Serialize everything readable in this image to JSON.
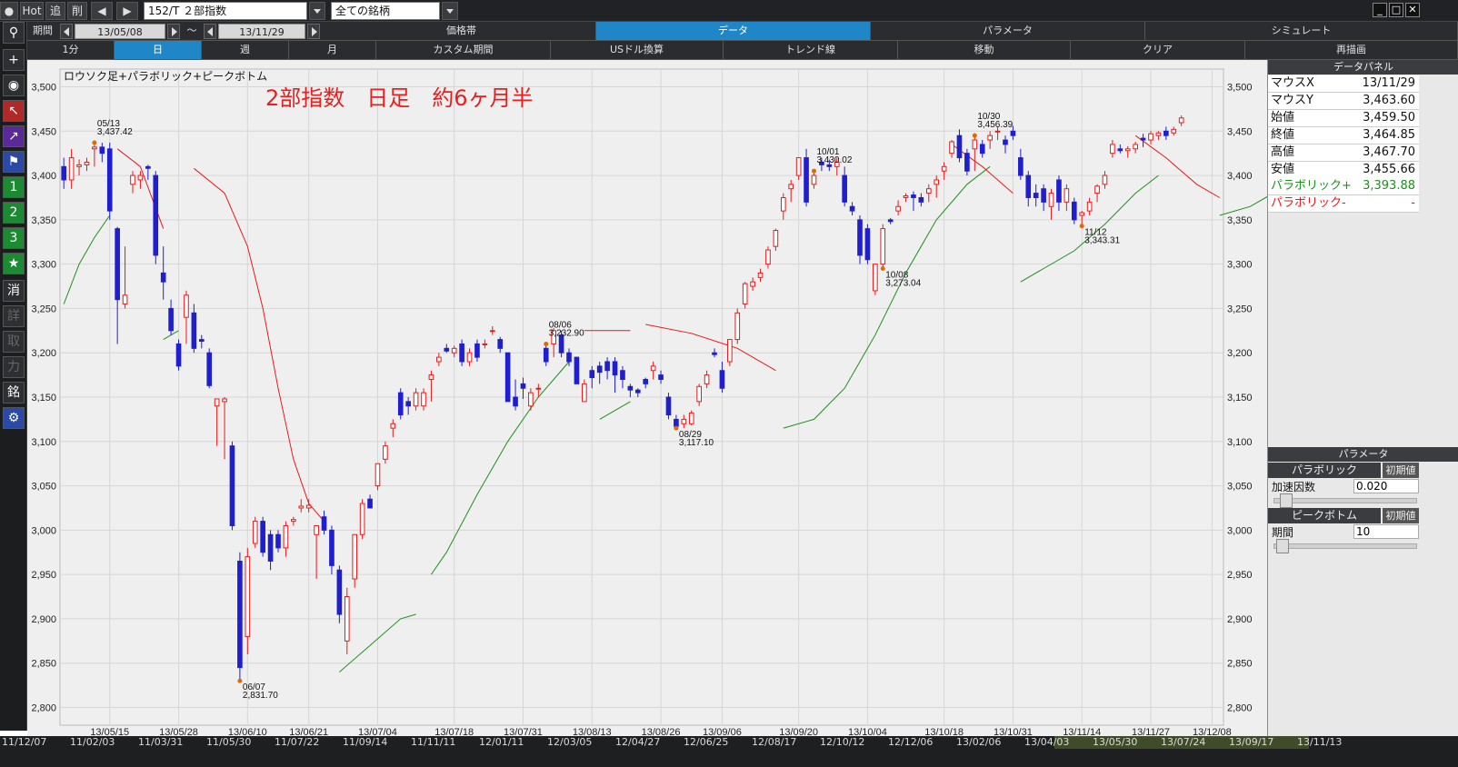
{
  "toolbar": {
    "hot": "Hot",
    "add": "追",
    "del": "削",
    "symbol": "152/T ２部指数",
    "filter": "全ての銘柄"
  },
  "period_row": {
    "label": "期間",
    "from": "13/05/08",
    "tilde": "～",
    "to": "13/11/29",
    "tabs": [
      "価格帯",
      "データ",
      "パラメータ",
      "シミュレート"
    ],
    "active_tab": 1
  },
  "interval_row": {
    "intervals": [
      "1分",
      "日",
      "週",
      "月"
    ],
    "active_interval": 1,
    "buttons": [
      "カスタム期間",
      "USドル換算",
      "トレンド線",
      "移動",
      "クリア",
      "再描画"
    ]
  },
  "left_tools": {
    "num1": "1",
    "num2": "2",
    "num3": "3",
    "k1": "消",
    "k2": "詳",
    "k3": "取",
    "k4": "力",
    "k5": "銘"
  },
  "chart_data": {
    "type": "candlestick",
    "indicator_label": "ロウソク足+パラボリック+ピークボトム",
    "title": "2部指数　日足　約6ヶ月半",
    "ylim": [
      2780,
      3520
    ],
    "y_ticks": [
      3500,
      3450,
      3400,
      3350,
      3300,
      3250,
      3200,
      3150,
      3100,
      3050,
      3000,
      2950,
      2900,
      2850,
      2800
    ],
    "y_tick_labels": [
      "3,500",
      "3,450",
      "3,400",
      "3,350",
      "3,300",
      "3,250",
      "3,200",
      "3,150",
      "3,100",
      "3,050",
      "3,000",
      "2,950",
      "2,900",
      "2,850",
      "2,800"
    ],
    "x_tick_labels": [
      "13/05/15",
      "13/05/28",
      "13/06/10",
      "13/06/21",
      "13/07/04",
      "13/07/18",
      "13/07/31",
      "13/08/13",
      "13/08/26",
      "13/09/06",
      "13/09/20",
      "13/10/04",
      "13/10/18",
      "13/10/31",
      "13/11/14",
      "13/11/27",
      "13/12/08"
    ],
    "x_tick_index": [
      6,
      15,
      24,
      32,
      41,
      51,
      60,
      69,
      78,
      86,
      96,
      105,
      115,
      124,
      133,
      142,
      150
    ],
    "n_slots": 152,
    "candles": [
      [
        3410,
        3420,
        3385,
        3395
      ],
      [
        3395,
        3430,
        3385,
        3420
      ],
      [
        3410,
        3418,
        3400,
        3412
      ],
      [
        3412,
        3420,
        3405,
        3415
      ],
      [
        3430,
        3437,
        3410,
        3432
      ],
      [
        3432,
        3437,
        3415,
        3425
      ],
      [
        3430,
        3437,
        3350,
        3360
      ],
      [
        3340,
        3342,
        3210,
        3260
      ],
      [
        3255,
        3320,
        3250,
        3265
      ],
      [
        3390,
        3405,
        3380,
        3400
      ],
      [
        3395,
        3405,
        3385,
        3400
      ],
      [
        3410,
        3412,
        3395,
        3408
      ],
      [
        3400,
        3405,
        3300,
        3310
      ],
      [
        3290,
        3320,
        3260,
        3280
      ],
      [
        3250,
        3260,
        3220,
        3225
      ],
      [
        3210,
        3215,
        3180,
        3185
      ],
      [
        3240,
        3270,
        3210,
        3265
      ],
      [
        3245,
        3255,
        3200,
        3205
      ],
      [
        3215,
        3220,
        3205,
        3213
      ],
      [
        3200,
        3205,
        3160,
        3163
      ],
      [
        3140,
        3145,
        3095,
        3148
      ],
      [
        3145,
        3150,
        3080,
        3148
      ],
      [
        3095,
        3100,
        3000,
        3005
      ],
      [
        2965,
        2975,
        2830,
        2845
      ],
      [
        2880,
        2980,
        2860,
        2970
      ],
      [
        2985,
        3015,
        2980,
        3010
      ],
      [
        3010,
        3015,
        2970,
        2975
      ],
      [
        2995,
        3000,
        2955,
        2965
      ],
      [
        2995,
        3000,
        2975,
        2980
      ],
      [
        2980,
        3010,
        2970,
        3005
      ],
      [
        3010,
        3015,
        3005,
        3012
      ],
      [
        3025,
        3035,
        3020,
        3027
      ],
      [
        3025,
        3035,
        3020,
        3028
      ],
      [
        2995,
        3000,
        2945,
        3005
      ],
      [
        3015,
        3022,
        2995,
        3000
      ],
      [
        3000,
        3005,
        2950,
        2960
      ],
      [
        2955,
        2960,
        2895,
        2905
      ],
      [
        2875,
        2935,
        2860,
        2925
      ],
      [
        2945,
        2995,
        2935,
        2995
      ],
      [
        2995,
        3035,
        2990,
        3030
      ],
      [
        3035,
        3030,
        3040,
        3025
      ],
      [
        3050,
        3075,
        3045,
        3075
      ],
      [
        3080,
        3100,
        3075,
        3095
      ],
      [
        3115,
        3125,
        3105,
        3120
      ],
      [
        3155,
        3160,
        3125,
        3130
      ],
      [
        3145,
        3150,
        3130,
        3140
      ],
      [
        3140,
        3160,
        3135,
        3155
      ],
      [
        3140,
        3160,
        3135,
        3155
      ],
      [
        3170,
        3180,
        3145,
        3175
      ],
      [
        3190,
        3200,
        3185,
        3195
      ],
      [
        3205,
        3210,
        3200,
        3202
      ],
      [
        3200,
        3208,
        3195,
        3205
      ],
      [
        3210,
        3215,
        3185,
        3190
      ],
      [
        3190,
        3205,
        3185,
        3200
      ],
      [
        3210,
        3215,
        3190,
        3195
      ],
      [
        3210,
        3215,
        3205,
        3210
      ],
      [
        3225,
        3230,
        3220,
        3225
      ],
      [
        3215,
        3218,
        3200,
        3205
      ],
      [
        3200,
        3195,
        3150,
        3145
      ],
      [
        3150,
        3170,
        3135,
        3140
      ],
      [
        3165,
        3172,
        3148,
        3160
      ],
      [
        3140,
        3160,
        3135,
        3155
      ],
      [
        3160,
        3165,
        3150,
        3160
      ],
      [
        3205,
        3210,
        3185,
        3190
      ],
      [
        3210,
        3228,
        3195,
        3225
      ],
      [
        3220,
        3225,
        3195,
        3200
      ],
      [
        3200,
        3205,
        3185,
        3190
      ],
      [
        3195,
        3190,
        3175,
        3165
      ],
      [
        3145,
        3170,
        3145,
        3165
      ],
      [
        3180,
        3185,
        3160,
        3172
      ],
      [
        3185,
        3190,
        3165,
        3178
      ],
      [
        3190,
        3195,
        3170,
        3180
      ],
      [
        3190,
        3195,
        3155,
        3175
      ],
      [
        3180,
        3185,
        3160,
        3170
      ],
      [
        3162,
        3165,
        3150,
        3158
      ],
      [
        3158,
        3160,
        3150,
        3155
      ],
      [
        3170,
        3172,
        3160,
        3165
      ],
      [
        3180,
        3190,
        3170,
        3185
      ],
      [
        3175,
        3180,
        3165,
        3170
      ],
      [
        3150,
        3155,
        3125,
        3130
      ],
      [
        3125,
        3130,
        3115,
        3117
      ],
      [
        3120,
        3130,
        3115,
        3125
      ],
      [
        3120,
        3135,
        3118,
        3132
      ],
      [
        3145,
        3165,
        3140,
        3162
      ],
      [
        3165,
        3180,
        3160,
        3175
      ],
      [
        3200,
        3205,
        3195,
        3198
      ],
      [
        3180,
        3190,
        3155,
        3160
      ],
      [
        3190,
        3215,
        3185,
        3215
      ],
      [
        3215,
        3250,
        3210,
        3245
      ],
      [
        3255,
        3280,
        3250,
        3278
      ],
      [
        3275,
        3285,
        3270,
        3280
      ],
      [
        3285,
        3295,
        3280,
        3290
      ],
      [
        3300,
        3320,
        3295,
        3316
      ],
      [
        3320,
        3340,
        3315,
        3338
      ],
      [
        3360,
        3380,
        3350,
        3375
      ],
      [
        3385,
        3395,
        3370,
        3390
      ],
      [
        3400,
        3420,
        3395,
        3420
      ],
      [
        3420,
        3430,
        3365,
        3370
      ],
      [
        3390,
        3405,
        3385,
        3400
      ],
      [
        3415,
        3420,
        3405,
        3412
      ],
      [
        3412,
        3418,
        3405,
        3410
      ],
      [
        3410,
        3420,
        3400,
        3415
      ],
      [
        3400,
        3410,
        3365,
        3370
      ],
      [
        3365,
        3370,
        3355,
        3360
      ],
      [
        3350,
        3355,
        3300,
        3310
      ],
      [
        3340,
        3345,
        3300,
        3305
      ],
      [
        3270,
        3300,
        3265,
        3300
      ],
      [
        3300,
        3345,
        3295,
        3340
      ],
      [
        3350,
        3352,
        3345,
        3348
      ],
      [
        3360,
        3372,
        3355,
        3365
      ],
      [
        3375,
        3380,
        3370,
        3377
      ],
      [
        3378,
        3382,
        3360,
        3375
      ],
      [
        3375,
        3380,
        3365,
        3370
      ],
      [
        3380,
        3390,
        3370,
        3385
      ],
      [
        3390,
        3400,
        3375,
        3395
      ],
      [
        3405,
        3415,
        3395,
        3410
      ],
      [
        3425,
        3440,
        3420,
        3438
      ],
      [
        3445,
        3452,
        3415,
        3420
      ],
      [
        3425,
        3430,
        3400,
        3405
      ],
      [
        3430,
        3445,
        3405,
        3440
      ],
      [
        3435,
        3440,
        3420,
        3425
      ],
      [
        3440,
        3450,
        3430,
        3445
      ],
      [
        3450,
        3455,
        3440,
        3450
      ],
      [
        3440,
        3445,
        3425,
        3435
      ],
      [
        3450,
        3456,
        3440,
        3445
      ],
      [
        3420,
        3430,
        3395,
        3400
      ],
      [
        3400,
        3405,
        3365,
        3375
      ],
      [
        3380,
        3390,
        3365,
        3375
      ],
      [
        3385,
        3390,
        3360,
        3370
      ],
      [
        3365,
        3385,
        3350,
        3380
      ],
      [
        3395,
        3400,
        3360,
        3370
      ],
      [
        3370,
        3390,
        3360,
        3385
      ],
      [
        3370,
        3375,
        3345,
        3350
      ],
      [
        3355,
        3360,
        3343,
        3358
      ],
      [
        3360,
        3375,
        3355,
        3370
      ],
      [
        3380,
        3390,
        3370,
        3388
      ],
      [
        3390,
        3405,
        3385,
        3400
      ],
      [
        3425,
        3440,
        3420,
        3435
      ],
      [
        3430,
        3435,
        3425,
        3428
      ],
      [
        3428,
        3433,
        3420,
        3430
      ],
      [
        3430,
        3438,
        3425,
        3435
      ],
      [
        3442,
        3447,
        3432,
        3440
      ],
      [
        3440,
        3450,
        3435,
        3447
      ],
      [
        3445,
        3450,
        3440,
        3448
      ],
      [
        3450,
        3455,
        3440,
        3445
      ],
      [
        3448,
        3455,
        3445,
        3452
      ],
      [
        3459.5,
        3467.7,
        3455.66,
        3464.85
      ]
    ],
    "parabolic_up": [
      [
        0,
        3255
      ],
      [
        2,
        3300
      ],
      [
        4,
        3330
      ],
      [
        6,
        3355
      ]
    ],
    "parabolic_up2": [
      [
        13,
        3215
      ],
      [
        15,
        3225
      ]
    ],
    "parabolic_down": [
      [
        7,
        3430
      ],
      [
        10,
        3410
      ],
      [
        13,
        3340
      ]
    ],
    "parabolic_down2": [
      [
        17,
        3408
      ],
      [
        21,
        3380
      ],
      [
        24,
        3320
      ],
      [
        26,
        3250
      ],
      [
        28,
        3160
      ],
      [
        30,
        3080
      ],
      [
        32,
        3030
      ],
      [
        34,
        3010
      ]
    ],
    "parabolic_up3": [
      [
        36,
        2840
      ],
      [
        40,
        2870
      ],
      [
        44,
        2900
      ],
      [
        46,
        2905
      ]
    ],
    "parabolic_up4": [
      [
        48,
        2950
      ],
      [
        50,
        2975
      ],
      [
        54,
        3040
      ],
      [
        58,
        3100
      ],
      [
        62,
        3150
      ],
      [
        66,
        3190
      ]
    ],
    "parabolic_up5": [
      [
        70,
        3125
      ],
      [
        74,
        3145
      ]
    ],
    "parabolic_down3": [
      [
        68,
        3225
      ],
      [
        74,
        3225
      ]
    ],
    "parabolic_down4": [
      [
        76,
        3232
      ],
      [
        82,
        3222
      ],
      [
        88,
        3205
      ],
      [
        93,
        3180
      ]
    ],
    "parabolic_up6": [
      [
        94,
        3115
      ],
      [
        98,
        3125
      ],
      [
        102,
        3160
      ],
      [
        106,
        3220
      ],
      [
        110,
        3290
      ],
      [
        114,
        3350
      ],
      [
        118,
        3390
      ],
      [
        121,
        3410
      ]
    ],
    "parabolic_down5": [
      [
        116,
        3435
      ],
      [
        120,
        3410
      ],
      [
        124,
        3380
      ]
    ],
    "parabolic_up7": [
      [
        125,
        3280
      ],
      [
        128,
        3295
      ],
      [
        132,
        3315
      ],
      [
        136,
        3345
      ],
      [
        140,
        3380
      ],
      [
        143,
        3400
      ]
    ],
    "parabolic_down6": [
      [
        140,
        3445
      ],
      [
        144,
        3420
      ],
      [
        148,
        3390
      ],
      [
        151,
        3375
      ]
    ],
    "parabolic_up8": [
      [
        151,
        3355
      ],
      [
        155,
        3365
      ],
      [
        159,
        3385
      ],
      [
        162,
        3405
      ]
    ],
    "peaks": [
      {
        "idx": 4,
        "date": "05/13",
        "value": "3,437.42",
        "pos": "top"
      },
      {
        "idx": 23,
        "date": "06/07",
        "value": "2,831.70",
        "pos": "bottom"
      },
      {
        "idx": 63,
        "date": "08/06",
        "value": "3,232.90",
        "pos": "top"
      },
      {
        "idx": 80,
        "date": "08/29",
        "value": "3,117.10",
        "pos": "bottom"
      },
      {
        "idx": 98,
        "date": "10/01",
        "value": "3,430.02",
        "pos": "top"
      },
      {
        "idx": 107,
        "date": "10/08",
        "value": "3,273.04",
        "pos": "bottom"
      },
      {
        "idx": 119,
        "date": "10/30",
        "value": "3,456.39",
        "pos": "top"
      },
      {
        "idx": 133,
        "date": "11/12",
        "value": "3,343.31",
        "pos": "bottom"
      }
    ]
  },
  "bottom_ticks": [
    "11/12/07",
    "11/02/03",
    "11/03/31",
    "11/05/30",
    "11/07/22",
    "11/09/14",
    "11/11/11",
    "12/01/11",
    "12/03/05",
    "12/04/27",
    "12/06/25",
    "12/08/17",
    "12/10/12",
    "12/12/06",
    "13/02/06",
    "13/04/03",
    "13/05/30",
    "13/07/24",
    "13/09/17",
    "13/11/13"
  ],
  "data_panel": {
    "title": "データパネル",
    "rows": [
      {
        "k": "マウスX",
        "v": "13/11/29"
      },
      {
        "k": "マウスY",
        "v": "3,463.60"
      },
      {
        "k": "始値",
        "v": "3,459.50"
      },
      {
        "k": "終値",
        "v": "3,464.85"
      },
      {
        "k": "高値",
        "v": "3,467.70"
      },
      {
        "k": "安値",
        "v": "3,455.66"
      }
    ],
    "para_plus_k": "パラボリック+",
    "para_plus_v": "3,393.88",
    "para_minus_k": "パラボリック-",
    "para_minus_v": "-"
  },
  "param_panel": {
    "title": "パラメータ",
    "section1": "パラボリック",
    "reset": "初期値",
    "accel_label": "加速因数",
    "accel_value": "0.020",
    "accel_level": 0.05,
    "section2": "ピークボトム",
    "period_label": "期間",
    "period_value": "10",
    "period_level": 0.02
  },
  "colors": {
    "up": "#e41b1b",
    "down": "#1f1fd0",
    "para_up": "#1f8f1f",
    "para_down": "#e41b1b",
    "title": "#e81f1f",
    "peak": "#e06a00"
  }
}
